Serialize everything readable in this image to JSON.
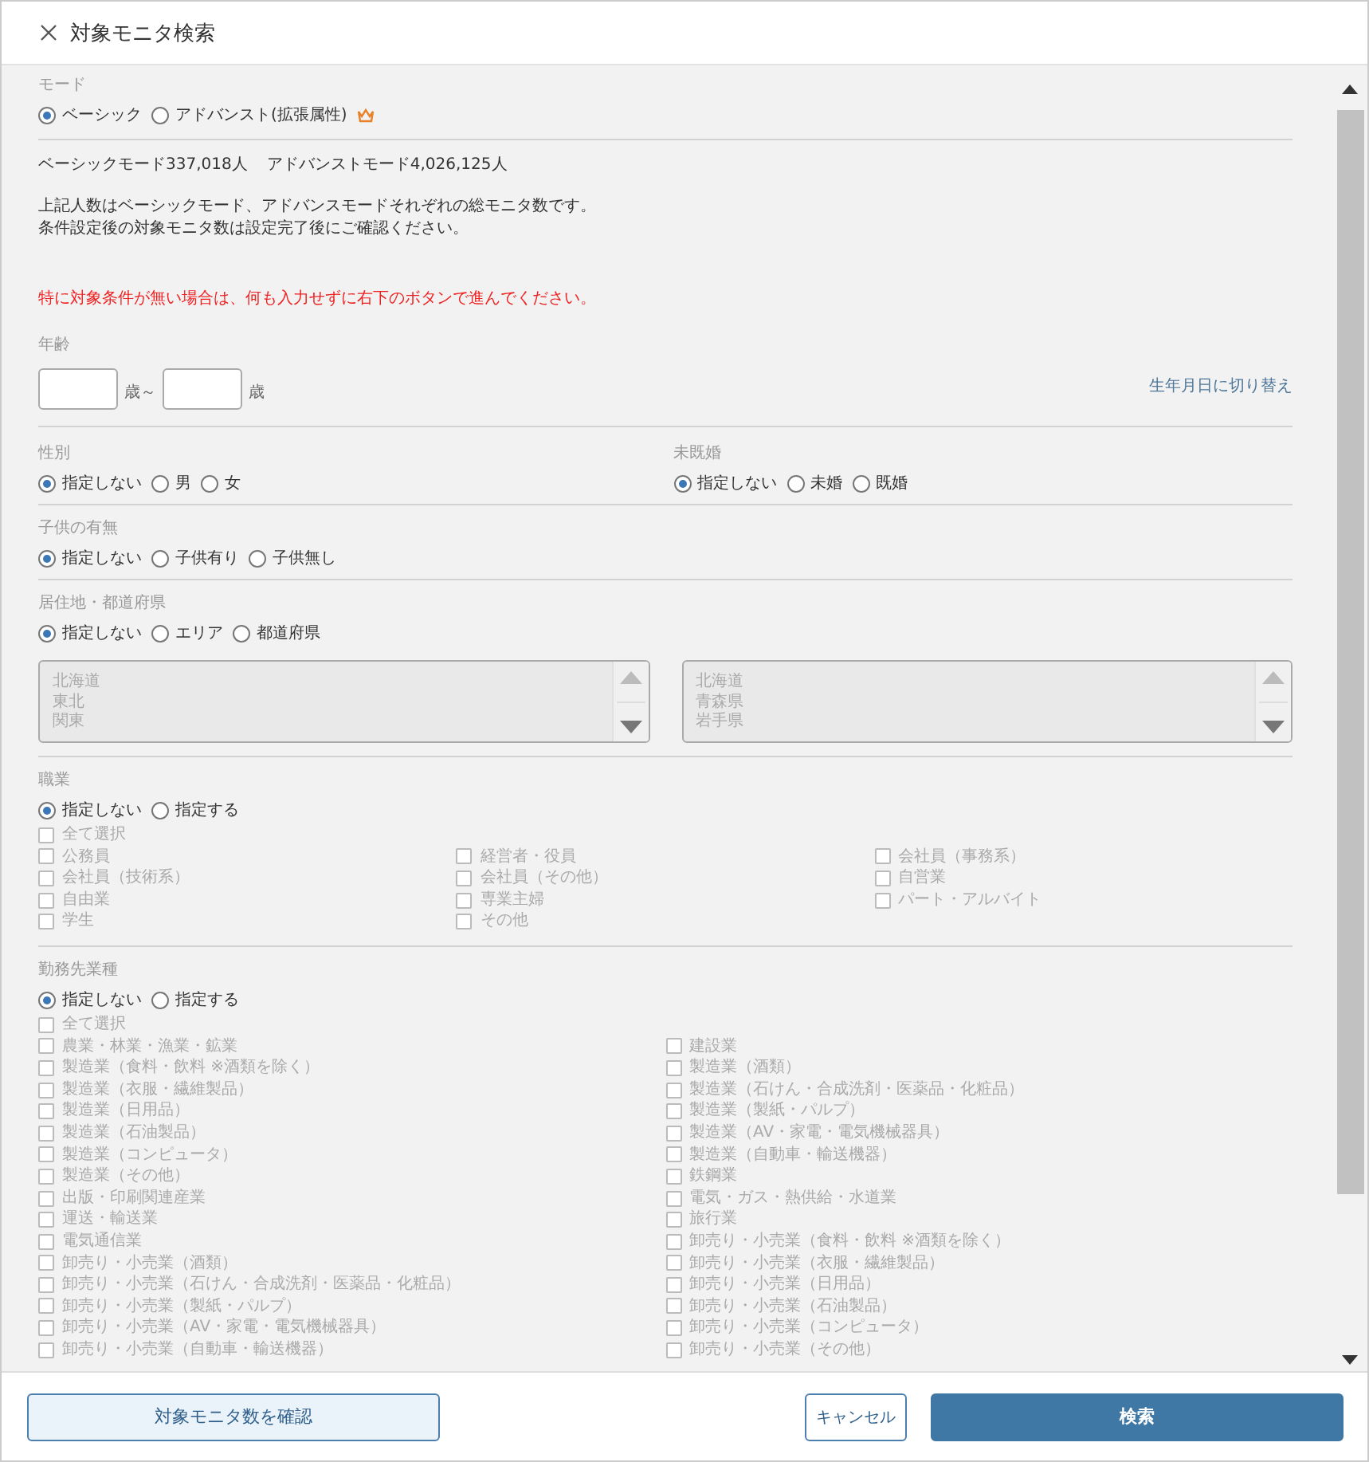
{
  "title": "対象モニタ検索",
  "mode": {
    "label": "モード",
    "options": [
      {
        "label": "ベーシック",
        "selected": true,
        "premium": false
      },
      {
        "label": "アドバンスト(拡張属性)",
        "selected": false,
        "premium": true
      }
    ]
  },
  "counts": [
    "ベーシックモード337,018人",
    "アドバンストモード4,026,125人"
  ],
  "notes": [
    "上記人数はベーシックモード、アドバンスモードそれぞれの総モニタ数です。",
    "条件設定後の対象モニタ数は設定完了後にご確認ください。"
  ],
  "warning": "特に対象条件が無い場合は、何も入力せずに右下のボタンで進んでください。",
  "age": {
    "label": "年齢",
    "from_unit": "歳～",
    "to_unit": "歳",
    "switch_link": "生年月日に切り替え"
  },
  "gender": {
    "label": "性別",
    "options": [
      {
        "label": "指定しない",
        "selected": true
      },
      {
        "label": "男",
        "selected": false
      },
      {
        "label": "女",
        "selected": false
      }
    ]
  },
  "marital": {
    "label": "未既婚",
    "options": [
      {
        "label": "指定しない",
        "selected": true
      },
      {
        "label": "未婚",
        "selected": false
      },
      {
        "label": "既婚",
        "selected": false
      }
    ]
  },
  "children": {
    "label": "子供の有無",
    "options": [
      {
        "label": "指定しない",
        "selected": true
      },
      {
        "label": "子供有り",
        "selected": false
      },
      {
        "label": "子供無し",
        "selected": false
      }
    ]
  },
  "residence": {
    "label": "居住地・都道府県",
    "options": [
      {
        "label": "指定しない",
        "selected": true
      },
      {
        "label": "エリア",
        "selected": false
      },
      {
        "label": "都道府県",
        "selected": false
      }
    ],
    "lists": [
      {
        "disabled": true,
        "items": [
          "北海道",
          "東北",
          "関東"
        ]
      },
      {
        "disabled": true,
        "items": [
          "北海道",
          "青森県",
          "岩手県"
        ]
      }
    ]
  },
  "occupation": {
    "label": "職業",
    "options": [
      {
        "label": "指定しない",
        "selected": true
      },
      {
        "label": "指定する",
        "selected": false
      }
    ],
    "disabled": true,
    "select_all": {
      "label": "全て選択",
      "checked": false
    },
    "items": [
      {
        "label": "公務員",
        "checked": false
      },
      {
        "label": "経営者・役員",
        "checked": false
      },
      {
        "label": "会社員（事務系）",
        "checked": false
      },
      {
        "label": "会社員（技術系）",
        "checked": false
      },
      {
        "label": "会社員（その他）",
        "checked": false
      },
      {
        "label": "自営業",
        "checked": false
      },
      {
        "label": "自由業",
        "checked": false
      },
      {
        "label": "専業主婦",
        "checked": false
      },
      {
        "label": "パート・アルバイト",
        "checked": false
      },
      {
        "label": "学生",
        "checked": false
      },
      {
        "label": "その他",
        "checked": false
      }
    ]
  },
  "industry": {
    "label": "勤務先業種",
    "options": [
      {
        "label": "指定しない",
        "selected": true
      },
      {
        "label": "指定する",
        "selected": false
      }
    ],
    "disabled": true,
    "select_all": {
      "label": "全て選択",
      "checked": false
    },
    "items": [
      {
        "label": "農業・林業・漁業・鉱業",
        "checked": false
      },
      {
        "label": "建設業",
        "checked": false
      },
      {
        "label": "製造業（食料・飲料 ※酒類を除く）",
        "checked": false
      },
      {
        "label": "製造業（酒類）",
        "checked": false
      },
      {
        "label": "製造業（衣服・繊維製品）",
        "checked": false
      },
      {
        "label": "製造業（石けん・合成洗剤・医薬品・化粧品）",
        "checked": false
      },
      {
        "label": "製造業（日用品）",
        "checked": false
      },
      {
        "label": "製造業（製紙・パルプ）",
        "checked": false
      },
      {
        "label": "製造業（石油製品）",
        "checked": false
      },
      {
        "label": "製造業（AV・家電・電気機械器具）",
        "checked": false
      },
      {
        "label": "製造業（コンピュータ）",
        "checked": false
      },
      {
        "label": "製造業（自動車・輸送機器）",
        "checked": false
      },
      {
        "label": "製造業（その他）",
        "checked": false
      },
      {
        "label": "鉄鋼業",
        "checked": false
      },
      {
        "label": "出版・印刷関連産業",
        "checked": false
      },
      {
        "label": "電気・ガス・熱供給・水道業",
        "checked": false
      },
      {
        "label": "運送・輸送業",
        "checked": false
      },
      {
        "label": "旅行業",
        "checked": false
      },
      {
        "label": "電気通信業",
        "checked": false
      },
      {
        "label": "卸売り・小売業（食料・飲料 ※酒類を除く）",
        "checked": false
      },
      {
        "label": "卸売り・小売業（酒類）",
        "checked": false
      },
      {
        "label": "卸売り・小売業（衣服・繊維製品）",
        "checked": false
      },
      {
        "label": "卸売り・小売業（石けん・合成洗剤・医薬品・化粧品）",
        "checked": false
      },
      {
        "label": "卸売り・小売業（日用品）",
        "checked": false
      },
      {
        "label": "卸売り・小売業（製紙・パルプ）",
        "checked": false
      },
      {
        "label": "卸売り・小売業（石油製品）",
        "checked": false
      },
      {
        "label": "卸売り・小売業（AV・家電・電気機械器具）",
        "checked": false
      },
      {
        "label": "卸売り・小売業（コンピュータ）",
        "checked": false
      },
      {
        "label": "卸売り・小売業（自動車・輸送機器）",
        "checked": false
      },
      {
        "label": "卸売り・小売業（その他）",
        "checked": false
      }
    ]
  },
  "buttons": [
    {
      "label": "対象モニタ数を確認",
      "kind": "secondary"
    },
    {
      "label": "キャンセル",
      "kind": "outline"
    },
    {
      "label": "検索",
      "kind": "primary"
    }
  ]
}
